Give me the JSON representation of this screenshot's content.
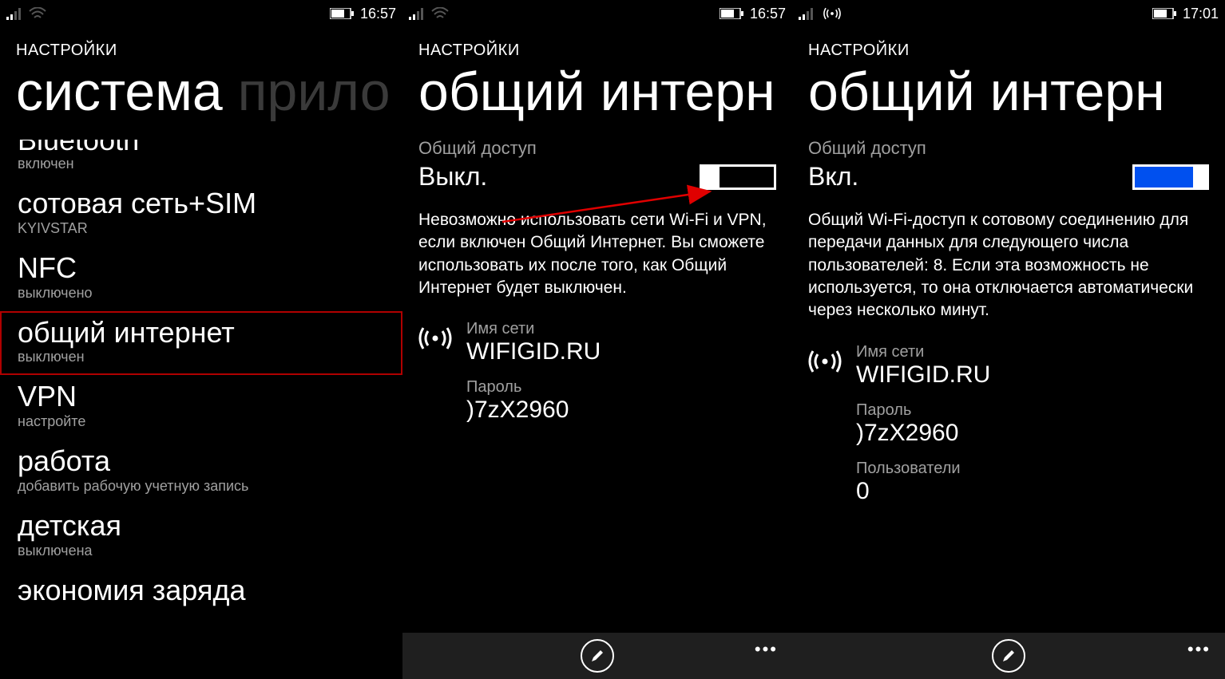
{
  "screen1": {
    "status": {
      "time": "16:57"
    },
    "section_label": "НАСТРОЙКИ",
    "pivot_primary": "система",
    "pivot_secondary": "прило",
    "items": [
      {
        "title_partial": "Bluetooth",
        "sub": "включен"
      },
      {
        "title": "сотовая сеть+SIM",
        "sub": "KYIVSTAR"
      },
      {
        "title": "NFC",
        "sub": "выключено"
      },
      {
        "title": "общий интернет",
        "sub": "выключен",
        "highlight": true
      },
      {
        "title": "VPN",
        "sub": "настройте"
      },
      {
        "title": "работа",
        "sub": "добавить рабочую учетную запись"
      },
      {
        "title": "детская",
        "sub": "выключена"
      },
      {
        "title": "экономия заряда",
        "sub": ""
      }
    ]
  },
  "screen2": {
    "status": {
      "time": "16:57"
    },
    "section_label": "НАСТРОЙКИ",
    "pivot_primary": "общий интерн",
    "share_label": "Общий доступ",
    "share_state": "Выкл.",
    "description": "Невозможно использовать сети Wi-Fi и VPN, если включен Общий Интернет. Вы сможете использовать их после того, как Общий Интернет будет выключен.",
    "net_name_label": "Имя сети",
    "net_name_value": "WIFIGID.RU",
    "pwd_label": "Пароль",
    "pwd_value": ")7zX2960"
  },
  "screen3": {
    "status": {
      "time": "17:01"
    },
    "section_label": "НАСТРОЙКИ",
    "pivot_primary": "общий интерн",
    "share_label": "Общий доступ",
    "share_state": "Вкл.",
    "description": "Общий Wi-Fi-доступ к сотовому соединению для передачи данных для следующего числа пользователей: 8. Если эта возможность не используется, то она отключается автоматически через несколько минут.",
    "net_name_label": "Имя сети",
    "net_name_value": "WIFIGID.RU",
    "pwd_label": "Пароль",
    "pwd_value": ")7zX2960",
    "users_label": "Пользователи",
    "users_value": "0"
  }
}
